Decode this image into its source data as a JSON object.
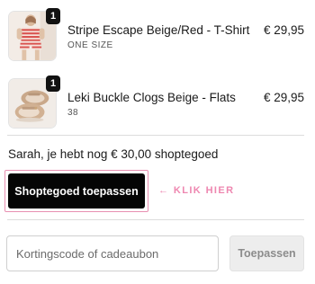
{
  "cart": {
    "items": [
      {
        "title": "Stripe Escape Beige/Red - T-Shirt",
        "variant": "ONE SIZE",
        "price": "€ 29,95",
        "quantity": "1",
        "image_icon": "striped-outfit-photo"
      },
      {
        "title": "Leki Buckle Clogs Beige - Flats",
        "variant": "38",
        "price": "€ 29,95",
        "quantity": "1",
        "image_icon": "clogs-photo"
      }
    ]
  },
  "store_credit": {
    "message": "Sarah, je hebt nog € 30,00 shoptegoed",
    "apply_label": "Shoptegoed toepassen",
    "hint": "← KLIK HIER",
    "colors": {
      "highlight": "#e88fb1",
      "hint": "#ee87b0",
      "button": "#050505"
    }
  },
  "discount": {
    "placeholder": "Kortingscode of cadeaubon",
    "value": "",
    "apply_label": "Toepassen"
  }
}
